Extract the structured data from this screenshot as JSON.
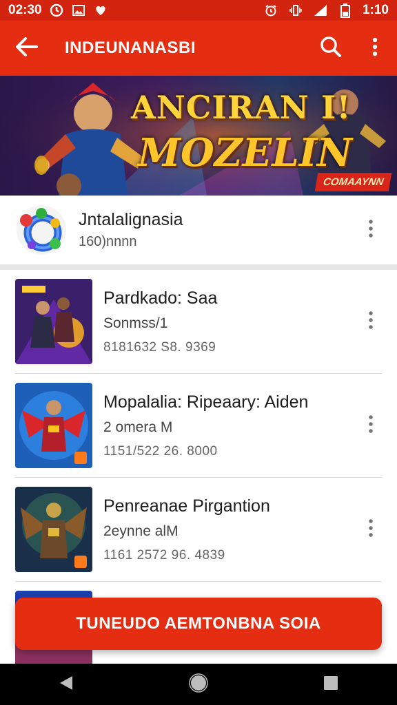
{
  "status_bar": {
    "time_left": "02:30",
    "time_right": "1:10",
    "icons_left": [
      "clock-icon",
      "gallery-icon",
      "heart-icon"
    ],
    "icons_right": [
      "alarm-icon",
      "vibrate-icon",
      "signal-icon",
      "battery-icon"
    ]
  },
  "app_bar": {
    "title": "INDEUNANASBI",
    "icons": [
      "back-arrow-icon",
      "search-icon",
      "overflow-menu-icon"
    ]
  },
  "banner": {
    "title": "ANCIRAN I!",
    "subtitle": "MOZELIN",
    "badge": "COMAAYNN"
  },
  "featured": {
    "name": "Jntalalignasia",
    "count": "160)nnnn",
    "icon": "game-logo-icon"
  },
  "games": [
    {
      "title": "Pardkado: Saa",
      "subtitle": "Sonmss/1",
      "meta": "8181632 S8. 9369"
    },
    {
      "title": "Mopalalia: Ripeaary: Aiden",
      "subtitle": "2 omera M",
      "meta": "1151/522 26. 8000"
    },
    {
      "title": "Penreanae Pirgantion",
      "subtitle": "2eynne alM",
      "meta": "1161 2572 96. 4839"
    },
    {
      "title": "",
      "subtitle": "",
      "meta": ""
    }
  ],
  "cta": {
    "label": "TUNEUDO AEMTONBNA SOIA"
  },
  "nav_bar": {
    "icons": [
      "back-triangle-icon",
      "home-circle-icon",
      "recents-square-icon"
    ]
  },
  "colors": {
    "primary": "#e52d12",
    "status_bar": "#d3240f",
    "banner_text": "#ffd43a"
  }
}
